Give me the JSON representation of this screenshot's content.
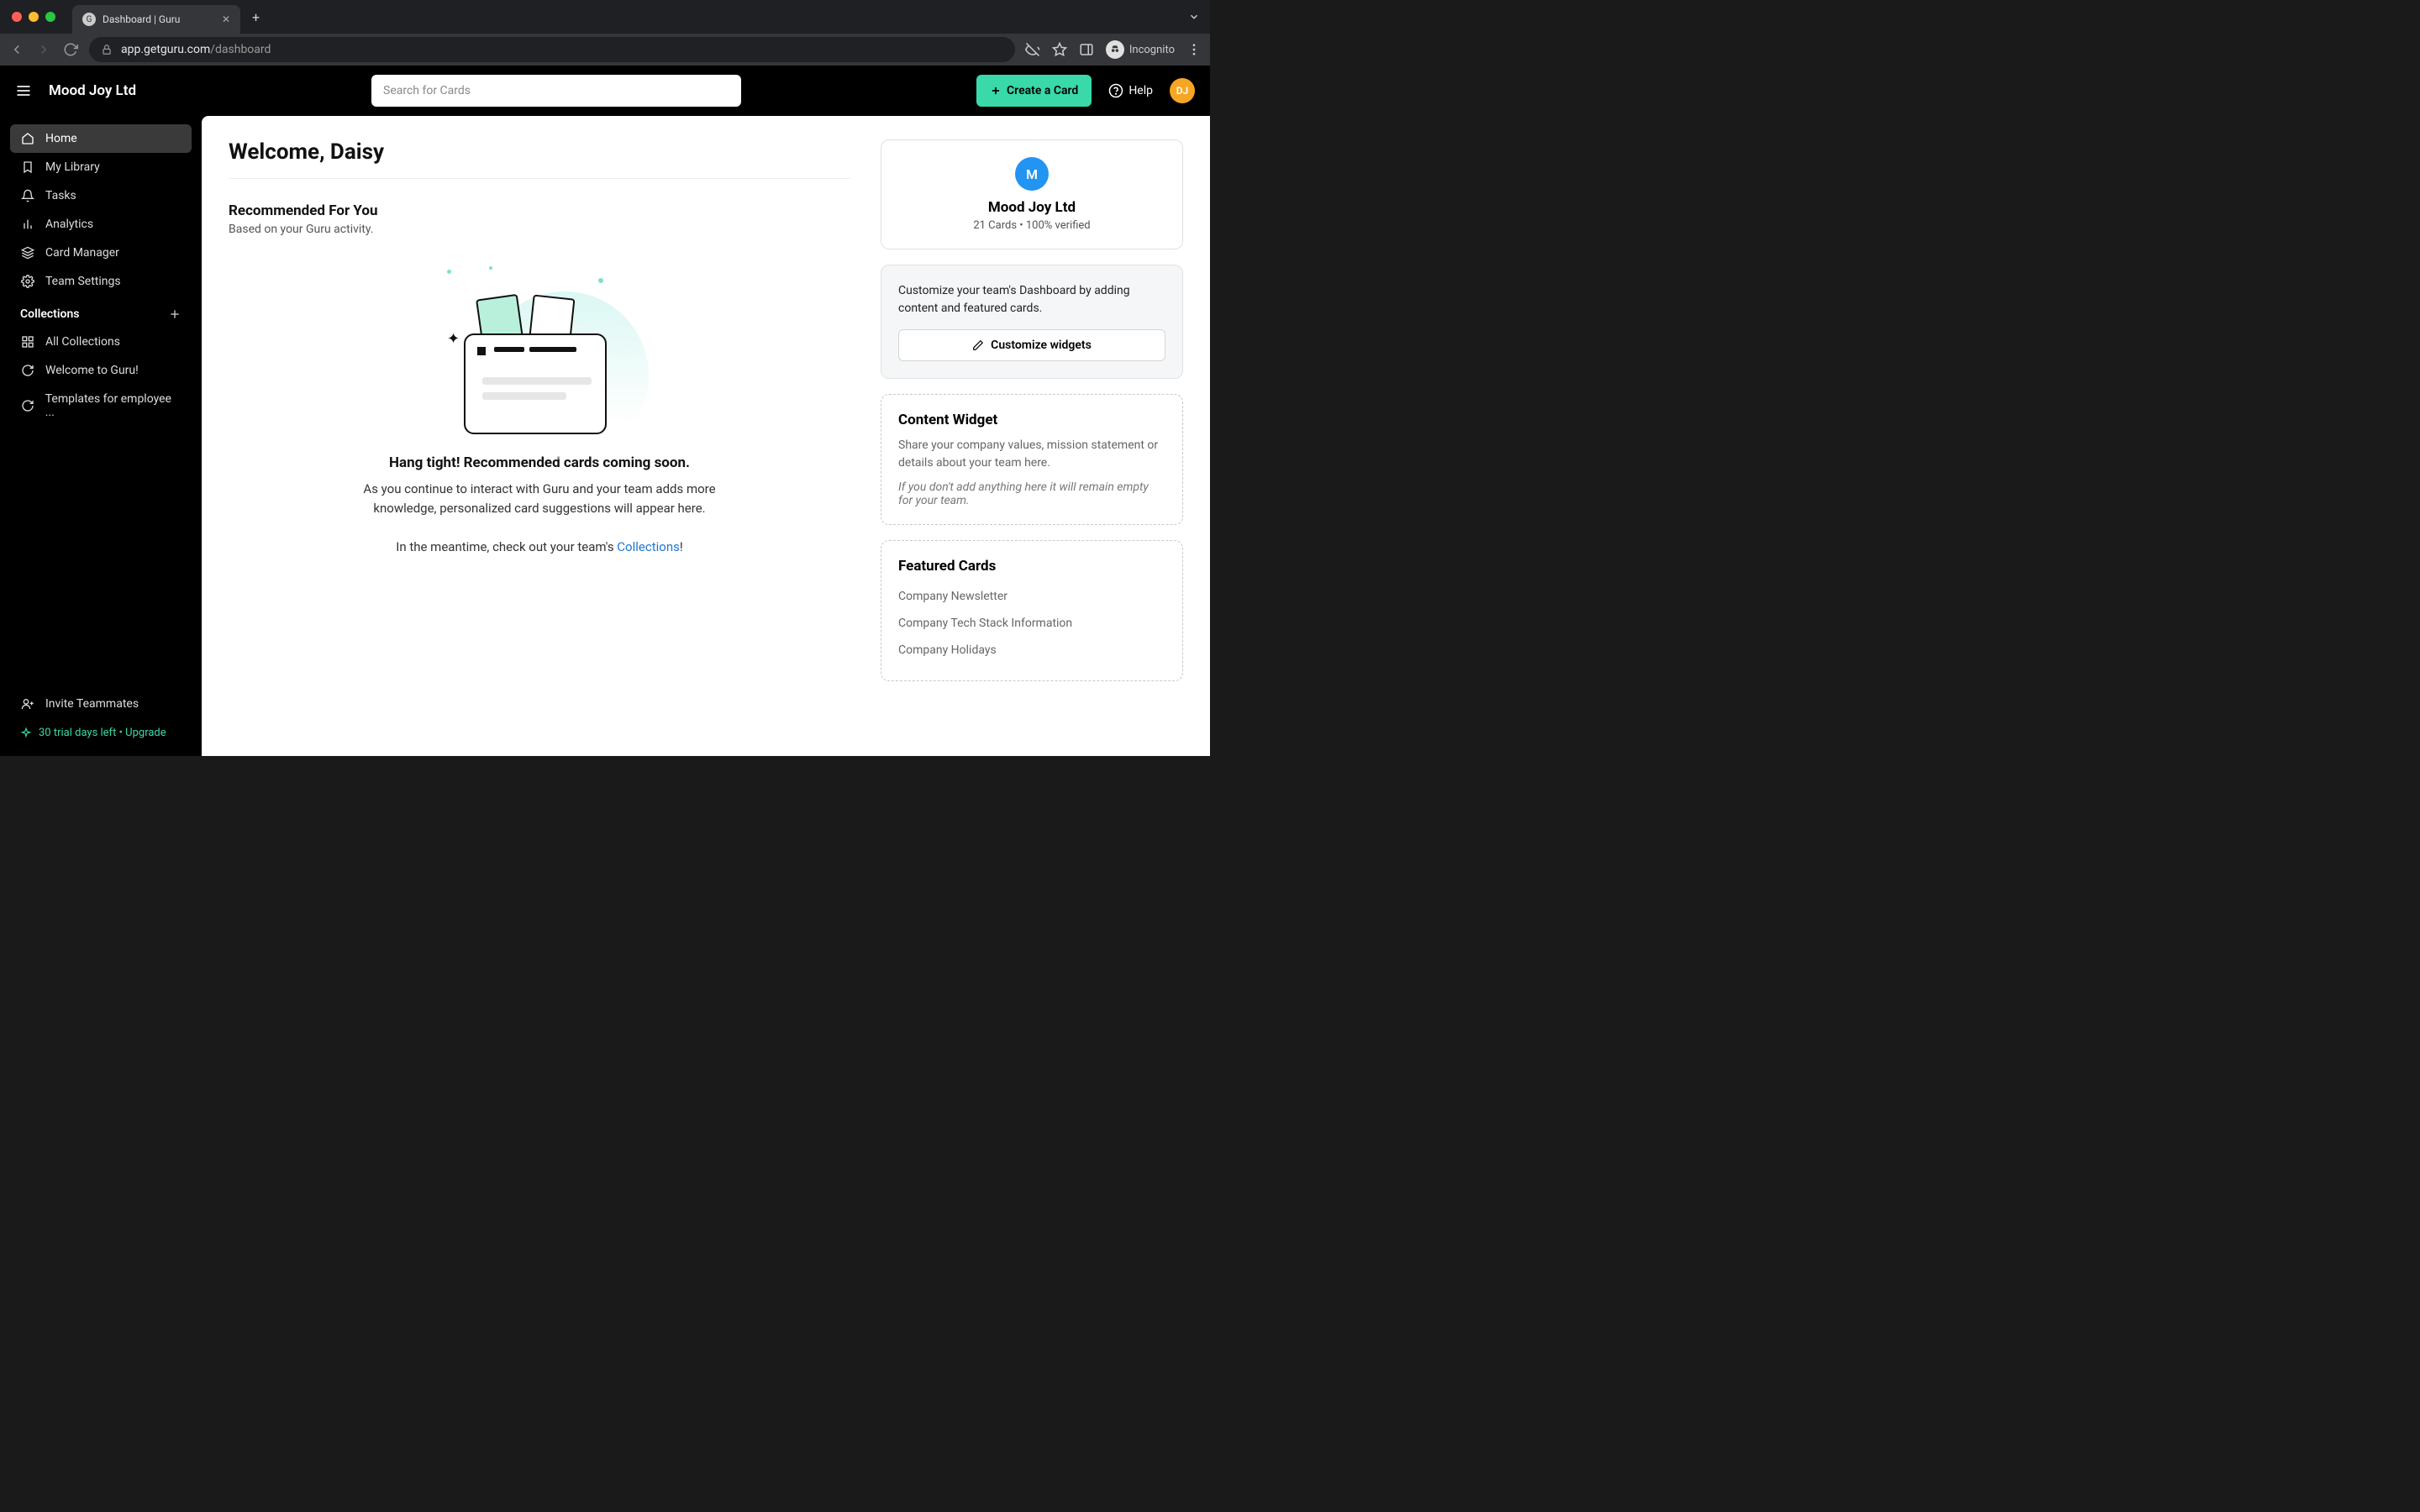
{
  "browser": {
    "tab_title": "Dashboard | Guru",
    "url_host": "app.getguru.com",
    "url_path": "/dashboard",
    "incognito_label": "Incognito"
  },
  "header": {
    "org_name": "Mood Joy Ltd",
    "search_placeholder": "Search for Cards",
    "create_card_label": "Create a Card",
    "help_label": "Help",
    "avatar_initials": "DJ"
  },
  "sidebar": {
    "items": [
      {
        "label": "Home",
        "icon": "home-icon",
        "active": true
      },
      {
        "label": "My Library",
        "icon": "bookmark-icon"
      },
      {
        "label": "Tasks",
        "icon": "bell-icon"
      },
      {
        "label": "Analytics",
        "icon": "bar-chart-icon"
      },
      {
        "label": "Card Manager",
        "icon": "layers-icon"
      },
      {
        "label": "Team Settings",
        "icon": "gear-icon"
      }
    ],
    "collections_header": "Collections",
    "collections": [
      {
        "label": "All Collections",
        "icon": "grid-icon"
      },
      {
        "label": "Welcome to Guru!",
        "icon": "refresh-icon"
      },
      {
        "label": "Templates for employee ...",
        "icon": "refresh-icon"
      }
    ],
    "invite_label": "Invite Teammates",
    "trial_label": "30 trial days left • Upgrade"
  },
  "main": {
    "welcome": "Welcome, Daisy",
    "recommended_title": "Recommended For You",
    "recommended_subtitle": "Based on your Guru activity.",
    "empty_heading": "Hang tight! Recommended cards coming soon.",
    "empty_body": "As you continue to interact with Guru and your team adds more knowledge, personalized card suggestions will appear here.",
    "empty_body2_prefix": "In the meantime, check out your team's ",
    "empty_body2_link": "Collections",
    "empty_body2_suffix": "!"
  },
  "right": {
    "team_initial": "M",
    "team_name": "Mood Joy Ltd",
    "team_stats": "21 Cards • 100% verified",
    "customize_text": "Customize your team's Dashboard by adding content and featured cards.",
    "customize_button": "Customize widgets",
    "content_widget_title": "Content Widget",
    "content_widget_desc": "Share your company values, mission statement or details about your team here.",
    "content_widget_italic": "If you don't add anything here it will remain empty for your team.",
    "featured_title": "Featured Cards",
    "featured_items": [
      "Company Newsletter",
      "Company Tech Stack Information",
      "Company Holidays"
    ]
  }
}
